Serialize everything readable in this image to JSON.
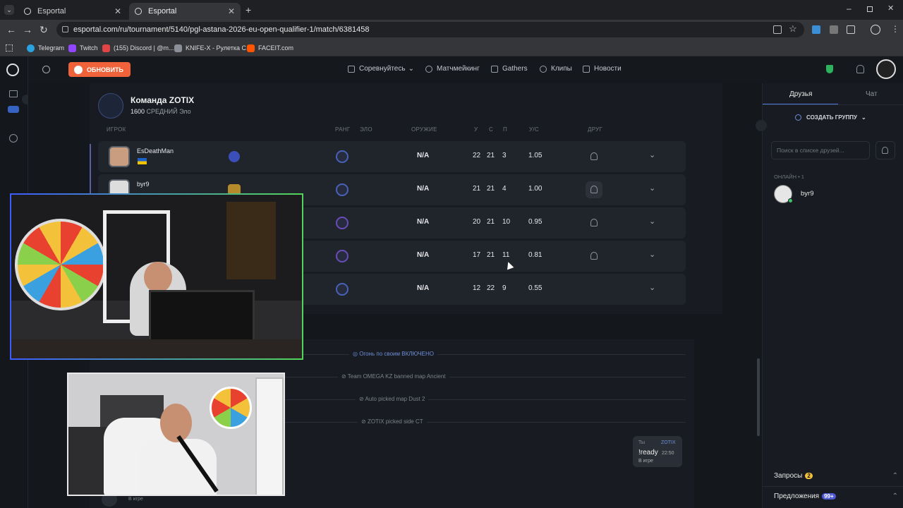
{
  "browser": {
    "tabs": [
      {
        "title": "Esportal"
      },
      {
        "title": "Esportal"
      }
    ],
    "url": "esportal.com/ru/tournament/5140/pgl-astana-2026-eu-open-qualifier-1/match/6381458",
    "bookmarks": [
      "Telegram",
      "Twitch",
      "(155) Discord | @m...",
      "KNIFE-X - Рулетка С...",
      "FACEIT.com"
    ]
  },
  "topnav": {
    "update_label": "ОБНОВИТЬ",
    "items": [
      "Соревнуйтесь",
      "Матчмейкинг",
      "Gathers",
      "Клипы",
      "Новости"
    ]
  },
  "team": {
    "name": "Команда ZOTIX",
    "elo_value": "1600",
    "elo_label": "СРЕДНИЙ Эло",
    "headers": {
      "player": "ИГРОК",
      "rank": "РАНГ",
      "elo": "ЭЛО",
      "weapon": "ОРУЖИЕ",
      "k": "У",
      "d": "С",
      "a": "П",
      "kd": "У/С",
      "friend": "ДРУГ"
    },
    "players": [
      {
        "name": "EsDeathMan",
        "weapon": "N/A",
        "k": "22",
        "d": "21",
        "a": "3",
        "kd": "1.05"
      },
      {
        "name": "byr9",
        "weapon": "N/A",
        "k": "21",
        "d": "21",
        "a": "4",
        "kd": "1.00"
      },
      {
        "name": "",
        "weapon": "N/A",
        "k": "20",
        "d": "21",
        "a": "10",
        "kd": "0.95"
      },
      {
        "name": "",
        "weapon": "N/A",
        "k": "17",
        "d": "21",
        "a": "11",
        "kd": "0.81"
      },
      {
        "name": "",
        "weapon": "N/A",
        "k": "12",
        "d": "22",
        "a": "9",
        "kd": "0.55"
      }
    ]
  },
  "log": {
    "events": [
      "Огонь по своим ВКЛЮЧЕНО",
      "Team OMEGA KZ banned map Ancient",
      "Auto picked map Dust 2",
      "ZOTIX picked side CT"
    ],
    "chat": {
      "you": "Ты",
      "author": "ZOTIX",
      "text": "!ready",
      "time": "22:50",
      "status": "В игре"
    },
    "bottom_status": "В игре"
  },
  "sidebar": {
    "tab_friends": "Друзья",
    "tab_chat": "Чат",
    "create_group": "СОЗДАТЬ ГРУППУ",
    "search_placeholder": "Поиск в списке друзей...",
    "online_label": "ОНЛАЙН • 1",
    "friend_name": "byr9",
    "requests_label": "Запросы",
    "requests_count": "2",
    "offers_label": "Предложения",
    "offers_count": "99+"
  },
  "colors": {
    "accent": "#f0633a",
    "panel": "#181b21",
    "row": "#20242b",
    "rank": "#4762b8",
    "online": "#3ec46d"
  }
}
